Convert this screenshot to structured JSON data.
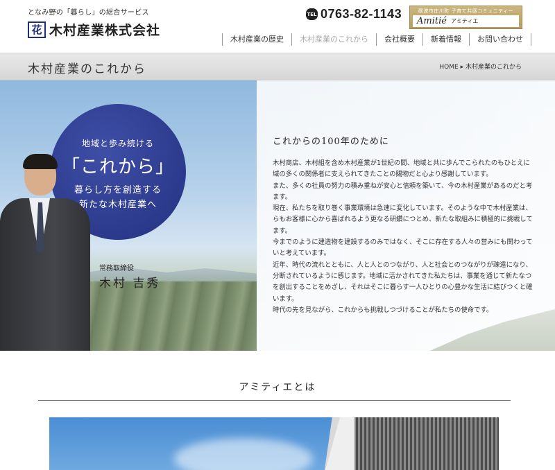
{
  "header": {
    "tagline": "となみ野の「暮らし」の総合サービス",
    "logo_mark": "花",
    "company_name": "木村産業株式会社",
    "tel_badge": "TEL",
    "tel_number": "0763-82-1143",
    "banner": {
      "top_text": "砺波市庄川町 子育て共感コミュニティー",
      "brand": "Amitié",
      "sub": "アミティエ"
    },
    "nav": [
      {
        "label": "木村産業の歴史",
        "active": false
      },
      {
        "label": "木村産業のこれから",
        "active": true
      },
      {
        "label": "会社概要",
        "active": false
      },
      {
        "label": "新着情報",
        "active": false
      },
      {
        "label": "お問い合わせ",
        "active": false
      }
    ]
  },
  "titlebar": {
    "title": "木村産業のこれから",
    "breadcrumb_home": "HOME",
    "breadcrumb_sep": "▸",
    "breadcrumb_current": "木村産業のこれから"
  },
  "hero": {
    "circle": {
      "line1": "地域と歩み続ける",
      "line2": "「これから」",
      "line3": "暮らし方を創造する",
      "line4": "新たな木村産業へ"
    },
    "role": "常務取締役",
    "name": "木村 吉秀",
    "message_title": "これからの100年のために",
    "message_lines": [
      "木村商店、木村組を含め木村産業が1世紀の間、地域と共に歩んでこられたのもひとえに",
      "域の多くの関係者に支えられてきたことの賜物だと心より感謝しています。",
      "また、多くの社員の努力の積み重ねが安心と信頼を築いて、今の木村産業があるのだと考",
      "ます。",
      "現在、私たちを取り巻く事業環境は急速に変化しています。そのような中で木村産業は、",
      "らもお客様に心から喜ばれるよう更なる研鑽につとめ、新たな取組みに積極的に挑戦して",
      "ます。",
      "今までのように建造物を建設するのみではなく、そこに存在する人々の営みにも関わって",
      "いと考えています。",
      "近年、時代の流れとともに、人と人とのつながり、人と社会とのつながりが疎遠になり、",
      "分断されているように感じます。地域に活かされてきた私たちは、事業を通じて新たなつ",
      "を創出することをめざし、それはそこに暮らす一人ひとりの心豊かな生活に結びつくと確",
      "います。",
      "時代の先を見ながら、これからも挑戦しつづけることが私たちの使命です。"
    ]
  },
  "section": {
    "title": "アミティエとは"
  }
}
